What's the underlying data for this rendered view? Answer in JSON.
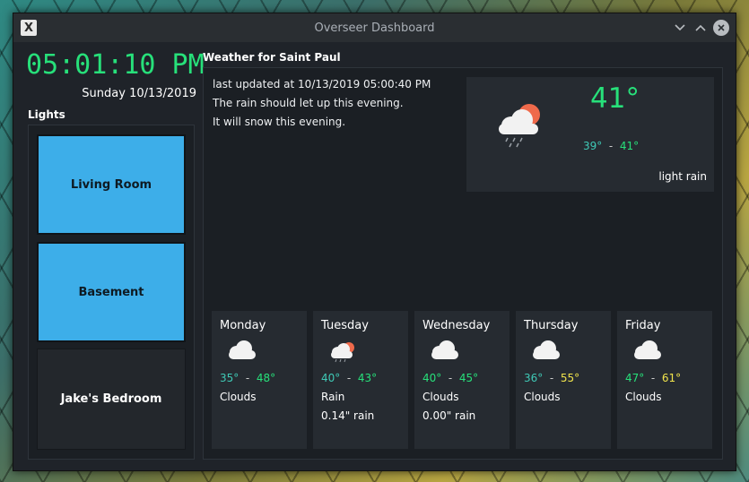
{
  "window": {
    "title": "Overseer Dashboard",
    "icon": "x-app-icon"
  },
  "clock": {
    "time": "05:01:10 PM",
    "date": "Sunday 10/13/2019"
  },
  "lights": {
    "title": "Lights",
    "items": [
      {
        "label": "Living Room",
        "state": "on"
      },
      {
        "label": "Basement",
        "state": "on"
      },
      {
        "label": "Jake's Bedroom",
        "state": "off"
      }
    ]
  },
  "weather": {
    "title": "Weather for Saint Paul",
    "updated": "last updated at 10/13/2019 05:00:40 PM",
    "notes": [
      "The rain should let up this evening.",
      "It will snow this evening."
    ],
    "current": {
      "temp": "41°",
      "low": "39°",
      "sep": "-",
      "high": "41°",
      "condition": "light rain",
      "icon": "rain-cloud-sun-icon"
    },
    "forecast": [
      {
        "day": "Monday",
        "low": "35°",
        "high": "48°",
        "condition": "Clouds",
        "rain": "",
        "icon": "cloud-icon"
      },
      {
        "day": "Tuesday",
        "low": "40°",
        "high": "43°",
        "condition": "Rain",
        "rain": "0.14\" rain",
        "icon": "rain-cloud-sun-icon"
      },
      {
        "day": "Wednesday",
        "low": "40°",
        "high": "45°",
        "condition": "Clouds",
        "rain": "0.00\" rain",
        "icon": "cloud-icon"
      },
      {
        "day": "Thursday",
        "low": "36°",
        "high": "55°",
        "condition": "Clouds",
        "rain": "",
        "icon": "cloud-icon"
      },
      {
        "day": "Friday",
        "low": "47°",
        "high": "61°",
        "condition": "Clouds",
        "rain": "",
        "icon": "cloud-icon"
      }
    ]
  },
  "colors": {
    "accent_green": "#27e07a",
    "teal": "#3fc9b6",
    "yellow": "#f1e44c",
    "light_on": "#3daee9"
  }
}
